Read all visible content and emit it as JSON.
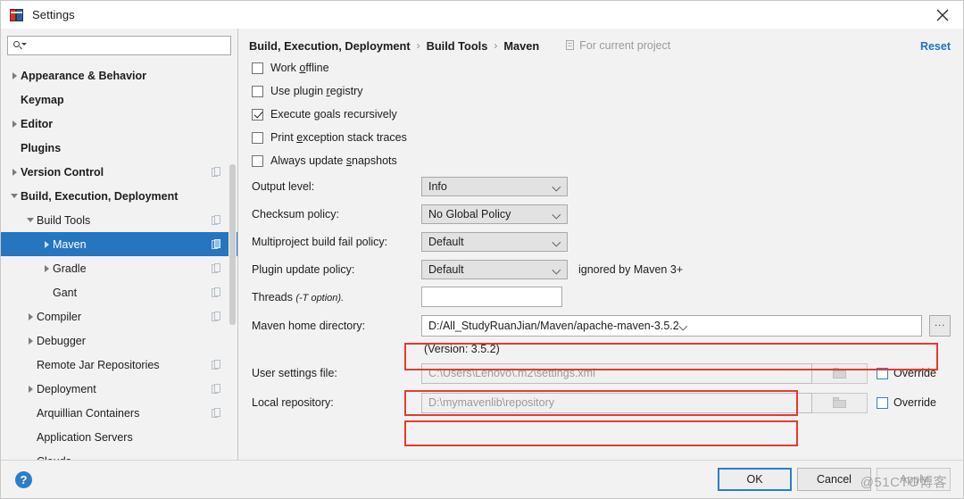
{
  "window": {
    "title": "Settings",
    "close_icon": "close-icon",
    "app_icon": "intellij-settings-icon"
  },
  "sidebar": {
    "search": {
      "placeholder": "",
      "value": "",
      "icon": "search-icon"
    },
    "items": [
      {
        "label": "Appearance & Behavior",
        "arrow": "collapsed",
        "bold": true,
        "indent": 0,
        "scope_icon": false,
        "selected": false
      },
      {
        "label": "Keymap",
        "arrow": "none",
        "bold": true,
        "indent": 0,
        "scope_icon": false,
        "selected": false
      },
      {
        "label": "Editor",
        "arrow": "collapsed",
        "bold": true,
        "indent": 0,
        "scope_icon": false,
        "selected": false
      },
      {
        "label": "Plugins",
        "arrow": "none",
        "bold": true,
        "indent": 0,
        "scope_icon": false,
        "selected": false
      },
      {
        "label": "Version Control",
        "arrow": "collapsed",
        "bold": true,
        "indent": 0,
        "scope_icon": true,
        "selected": false
      },
      {
        "label": "Build, Execution, Deployment",
        "arrow": "expanded",
        "bold": true,
        "indent": 0,
        "scope_icon": false,
        "selected": false
      },
      {
        "label": "Build Tools",
        "arrow": "expanded",
        "bold": false,
        "indent": 1,
        "scope_icon": true,
        "selected": false
      },
      {
        "label": "Maven",
        "arrow": "collapsed",
        "bold": false,
        "indent": 2,
        "scope_icon": true,
        "selected": true
      },
      {
        "label": "Gradle",
        "arrow": "collapsed",
        "bold": false,
        "indent": 2,
        "scope_icon": true,
        "selected": false
      },
      {
        "label": "Gant",
        "arrow": "none",
        "bold": false,
        "indent": 2,
        "scope_icon": true,
        "selected": false
      },
      {
        "label": "Compiler",
        "arrow": "collapsed",
        "bold": false,
        "indent": 1,
        "scope_icon": true,
        "selected": false
      },
      {
        "label": "Debugger",
        "arrow": "collapsed",
        "bold": false,
        "indent": 1,
        "scope_icon": false,
        "selected": false
      },
      {
        "label": "Remote Jar Repositories",
        "arrow": "none",
        "bold": false,
        "indent": 1,
        "scope_icon": true,
        "selected": false
      },
      {
        "label": "Deployment",
        "arrow": "collapsed",
        "bold": false,
        "indent": 1,
        "scope_icon": true,
        "selected": false
      },
      {
        "label": "Arquillian Containers",
        "arrow": "none",
        "bold": false,
        "indent": 1,
        "scope_icon": true,
        "selected": false
      },
      {
        "label": "Application Servers",
        "arrow": "none",
        "bold": false,
        "indent": 1,
        "scope_icon": false,
        "selected": false
      },
      {
        "label": "Clouds",
        "arrow": "none",
        "bold": false,
        "indent": 1,
        "scope_icon": false,
        "selected": false
      }
    ]
  },
  "main": {
    "breadcrumb": [
      "Build, Execution, Deployment",
      "Build Tools",
      "Maven"
    ],
    "breadcrumb_separator": "›",
    "scope_note": "For current project",
    "reset_label": "Reset",
    "checkboxes": [
      {
        "label_pre": "Work ",
        "label_mn": "o",
        "label_post": "ffline",
        "checked": false
      },
      {
        "label_pre": "Use plugin ",
        "label_mn": "r",
        "label_post": "egistry",
        "checked": false
      },
      {
        "label_pre": "Execute ",
        "label_mn": "g",
        "label_post": "oals recursively",
        "checked": true
      },
      {
        "label_pre": "Print ",
        "label_mn": "e",
        "label_post": "xception stack traces",
        "checked": false
      },
      {
        "label_pre": "Always update ",
        "label_mn": "s",
        "label_post": "napshots",
        "checked": false
      }
    ],
    "combos": [
      {
        "label": "Output level:",
        "value": "Info"
      },
      {
        "label": "Checksum policy:",
        "value": "No Global Policy"
      },
      {
        "label": "Multiproject build fail policy:",
        "value": "Default"
      },
      {
        "label": "Plugin update policy:",
        "value": "Default",
        "hint": "ignored by Maven 3+"
      }
    ],
    "threads": {
      "label": "Threads",
      "label_italic": "(-T option).",
      "value": "",
      "placeholder": ""
    },
    "maven_home": {
      "label": "Maven home directory:",
      "value": "D:/All_StudyRuanJian/Maven/apache-maven-3.5.2",
      "browse_label": "...",
      "version_note": "(Version: 3.5.2)",
      "highlighted": true
    },
    "user_settings": {
      "label": "User settings file:",
      "value": "C:\\Users\\Lenovo\\.m2\\settings.xml",
      "override_label": "Override",
      "override_checked": false,
      "highlighted": true
    },
    "local_repository": {
      "label": "Local repository:",
      "value": "D:\\mymavenlib\\repository",
      "override_label": "Override",
      "override_checked": false,
      "highlighted": true
    }
  },
  "footer": {
    "help_icon": "?",
    "buttons": [
      {
        "label": "OK",
        "style": "default"
      },
      {
        "label": "Cancel",
        "style": "normal"
      },
      {
        "label": "Apply",
        "style": "disabled"
      }
    ]
  },
  "watermark": {
    "text": "@51CTO博客"
  },
  "colors": {
    "accent_blue": "#2675bf",
    "link_blue": "#2470c4",
    "annotation_red": "#e8392f",
    "panel_bg": "#f2f2f2"
  }
}
